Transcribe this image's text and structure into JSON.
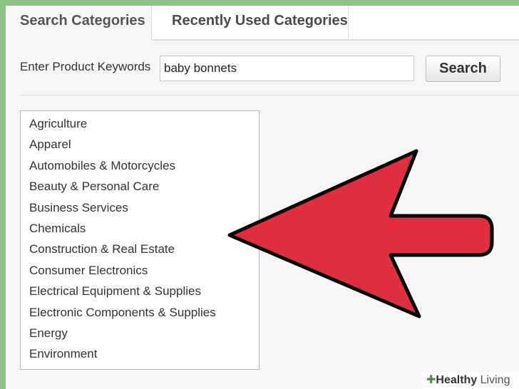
{
  "tabs": {
    "search_categories": "Search Categories",
    "recently_used": "Recently Used Categories"
  },
  "keywords": {
    "label": "Enter Product Keywords",
    "value": "baby bonnets",
    "button": "Search"
  },
  "categories": [
    "Agriculture",
    "Apparel",
    "Automobiles & Motorcycles",
    "Beauty & Personal Care",
    "Business Services",
    "Chemicals",
    "Construction & Real Estate",
    "Consumer Electronics",
    "Electrical Equipment & Supplies",
    "Electronic Components & Supplies",
    "Energy",
    "Environment"
  ],
  "watermark": {
    "brand_bold": "Healthy",
    "brand_rest": "Living"
  },
  "colors": {
    "border_frame": "#8cc084",
    "arrow_fill": "#e0303f",
    "arrow_stroke": "#000000"
  },
  "icons": {
    "arrow": "left-arrow-annotation-icon",
    "watermark": "plus-icon"
  }
}
